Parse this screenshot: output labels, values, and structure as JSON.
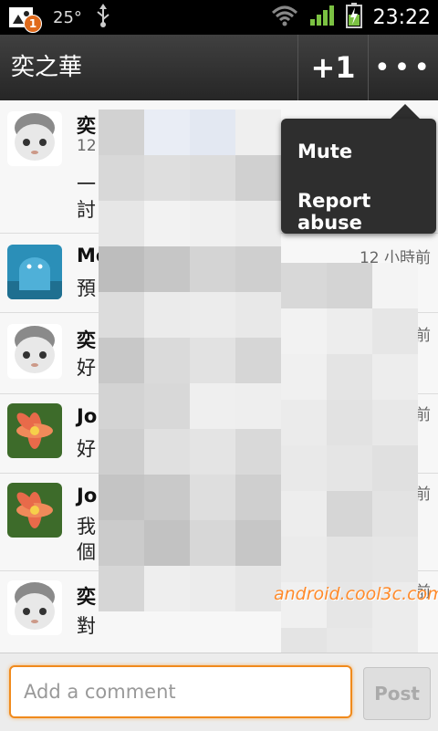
{
  "status_bar": {
    "notification_count": "1",
    "temperature": "25°",
    "time": "23:22",
    "icons": [
      "notification-icon",
      "usb-icon",
      "wifi-icon",
      "signal-icon",
      "battery-icon"
    ]
  },
  "header": {
    "title": "奕之華",
    "plus_one_label": "+1",
    "more_label": "•••"
  },
  "menu": {
    "items": [
      {
        "label": "Mute"
      },
      {
        "label": "Report abuse"
      }
    ]
  },
  "comments": [
    {
      "name": "奕",
      "sub": "12",
      "lines": [
        "一",
        "討"
      ],
      "time": "",
      "avatar": "gray-doll"
    },
    {
      "name": "Me",
      "lines": [
        "預"
      ],
      "time": "12 小時前",
      "avatar": "android-blue"
    },
    {
      "name": "奕",
      "lines": [
        "好"
      ],
      "time": "小時前",
      "avatar": "gray-doll"
    },
    {
      "name": "Jo",
      "lines": [
        "好"
      ],
      "time": "小時前",
      "avatar": "flower"
    },
    {
      "name": "Jo",
      "lines": [
        "我",
        "個"
      ],
      "time": "分鐘前",
      "avatar": "flower"
    },
    {
      "name": "奕",
      "lines": [
        "對"
      ],
      "time": "分鐘前",
      "end": "了",
      "avatar": "gray-doll"
    }
  ],
  "watermark": "android.cool3c.com",
  "compose": {
    "placeholder": "Add a comment",
    "post_label": "Post"
  },
  "colors": {
    "accent": "#f08a1c",
    "title_bar": "#333333",
    "menu_bg": "#2e2e2e"
  }
}
